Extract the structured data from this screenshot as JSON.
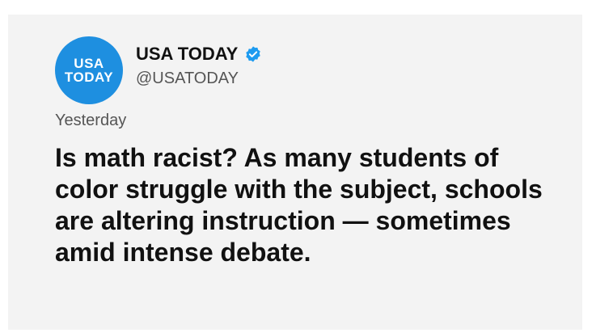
{
  "tweet": {
    "avatar": {
      "line1": "USA",
      "line2": "TODAY",
      "color": "#1e8fe0"
    },
    "account_name": "USA TODAY",
    "verified_icon": "verified-badge-icon",
    "handle": "@USATODAY",
    "timestamp": "Yesterday",
    "text": "Is math racist? As many students of color struggle with the subject, schools are altering instruction —  sometimes amid intense debate."
  },
  "colors": {
    "card_background": "#f3f3f3",
    "verified_blue": "#1d9bf0"
  }
}
